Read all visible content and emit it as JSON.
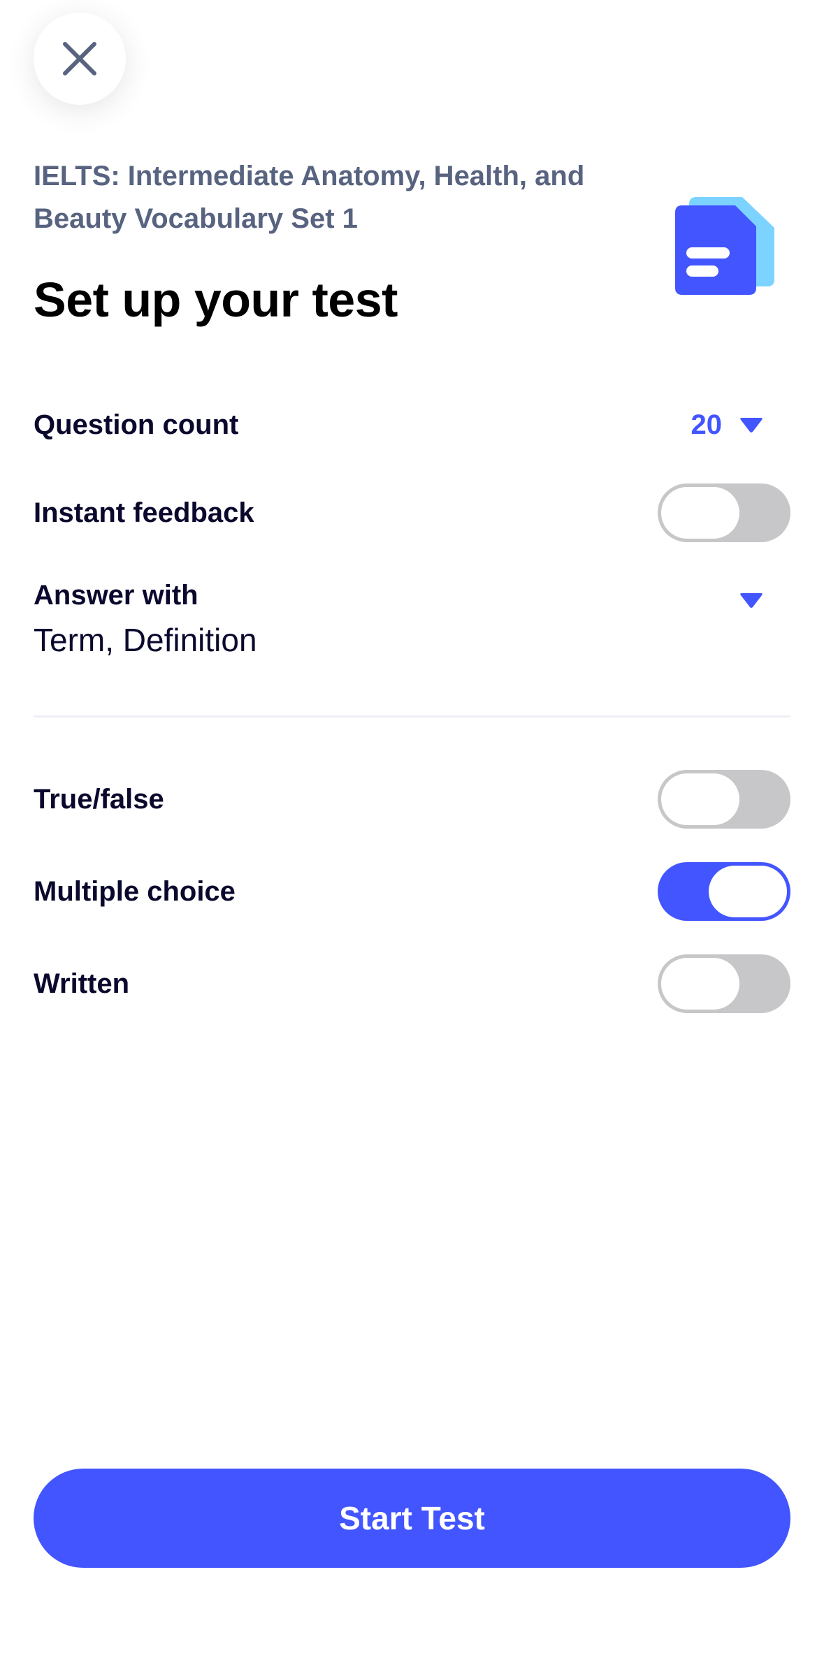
{
  "header": {
    "close_icon": "close-icon",
    "set_title": "IELTS: Intermediate Anatomy, Health, and Beauty Vocabulary Set 1",
    "page_title": "Set up your test",
    "doc_icon": "document-stack-icon"
  },
  "settings": {
    "question_count": {
      "label": "Question count",
      "value": "20"
    },
    "instant_feedback": {
      "label": "Instant feedback",
      "enabled": false
    },
    "answer_with": {
      "label": "Answer with",
      "value": "Term, Definition"
    }
  },
  "question_types": {
    "true_false": {
      "label": "True/false",
      "enabled": false
    },
    "multiple_choice": {
      "label": "Multiple choice",
      "enabled": true
    },
    "written": {
      "label": "Written",
      "enabled": false
    }
  },
  "footer": {
    "start_label": "Start Test"
  },
  "colors": {
    "accent": "#4255ff",
    "toggle_off": "#c7c7c9",
    "subtitle": "#586380",
    "doc_icon_back": "#7cd3ff"
  }
}
